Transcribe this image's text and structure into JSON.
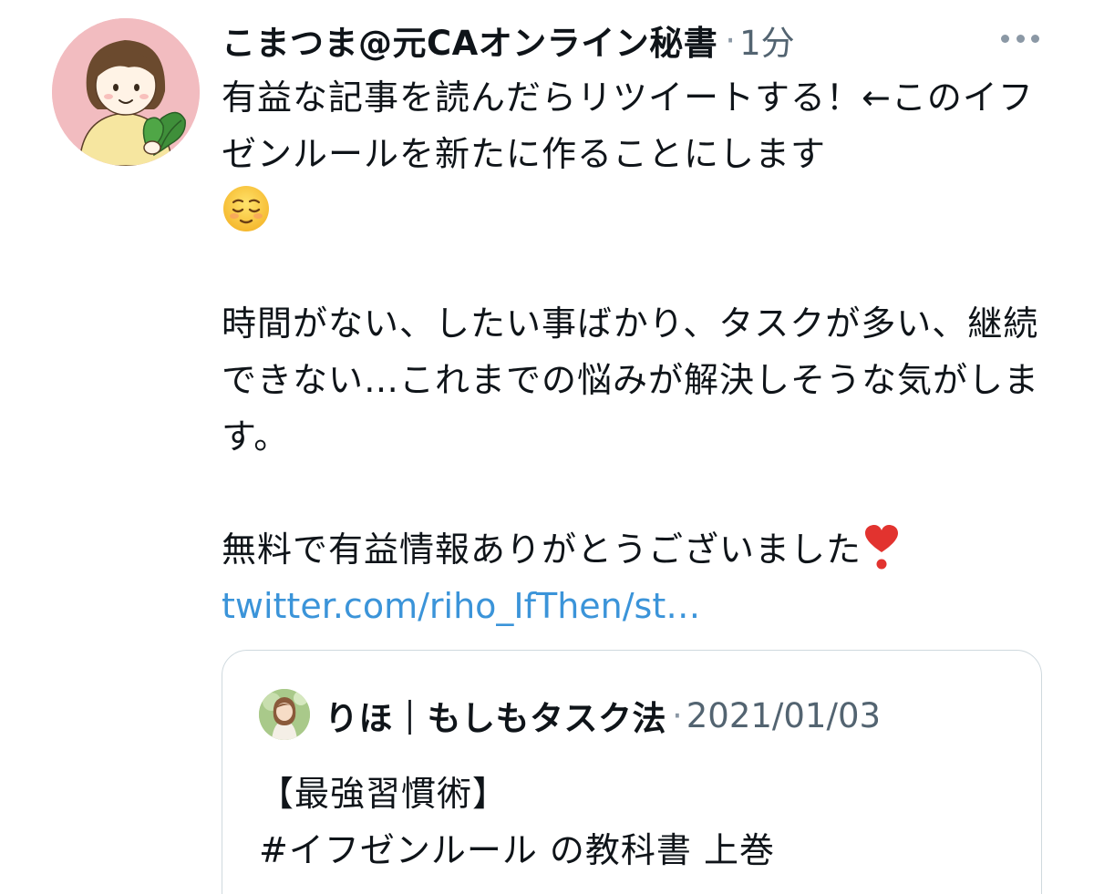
{
  "tweet": {
    "author": {
      "display_name": "こまつま@元CAオンライン秘書",
      "avatar_caption": "こまつま"
    },
    "separator": "·",
    "timestamp": "1分",
    "more_icon": "more-horizontal-icon",
    "text": {
      "line1": "有益な記事を読んだらリツイートする！←このイフゼンルールを新たに作ることにします",
      "emoji1": "relieved-face-emoji",
      "para2": "時間がない、したい事ばかり、タスクが多い、継続できない…これまでの悩みが解決しそうな気がします。",
      "para3": "無料で有益情報ありがとうございました",
      "emoji2": "heart-exclamation-emoji",
      "link": "twitter.com/riho_IfThen/st…"
    }
  },
  "quote": {
    "author": {
      "display_name": "りほ｜もしもタスク法"
    },
    "separator": "·",
    "date": "2021/01/03",
    "text": {
      "line1": "【最強習慣術】",
      "line2": "#イフゼンルール の教科書 上巻"
    }
  },
  "colors": {
    "link": "#3b94d9",
    "secondary_text": "#536471",
    "border": "#cfd9de",
    "avatar_bg": "#f2bcc0"
  }
}
